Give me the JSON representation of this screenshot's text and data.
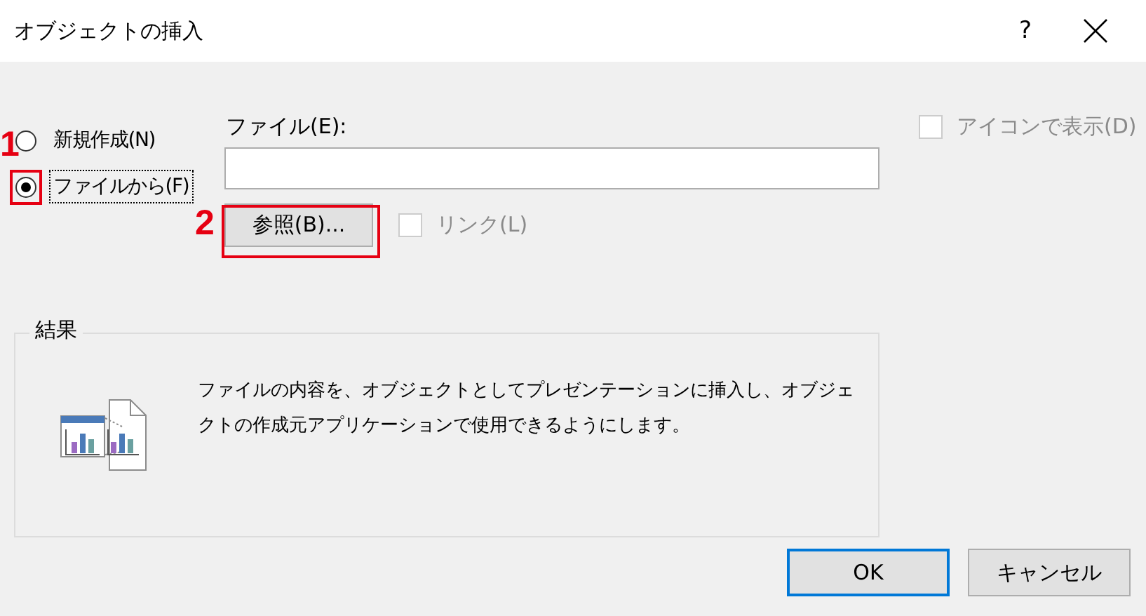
{
  "window": {
    "title": "オブジェクトの挿入",
    "help": "?"
  },
  "source_options": [
    {
      "label": "新規作成(N)",
      "selected": false,
      "focused": false
    },
    {
      "label": "ファイルから(F)",
      "selected": true,
      "focused": true
    }
  ],
  "file": {
    "label": "ファイル(E):",
    "browse_button": "参照(B)...",
    "link": {
      "label": "リンク(L)",
      "checked": false,
      "disabled": true
    }
  },
  "display_as_icon": {
    "label": "アイコンで表示(D)",
    "checked": false,
    "disabled": true
  },
  "result": {
    "title": "結果",
    "description": "ファイルの内容を、オブジェクトとしてプレゼンテーションに挿入し、オブジェクトの作成元アプリケーションで使用できるようにします。"
  },
  "buttons": [
    {
      "label": "OK",
      "default": true
    },
    {
      "label": "キャンセル",
      "default": false
    }
  ],
  "annotations": [
    {
      "label": "1"
    },
    {
      "label": "2"
    }
  ]
}
